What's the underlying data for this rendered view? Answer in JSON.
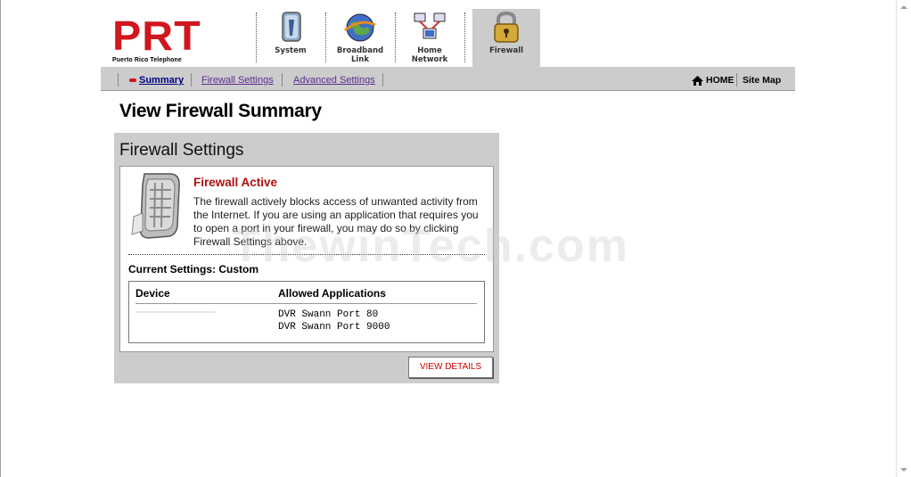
{
  "logo": {
    "text": "PRT",
    "tagline": "Puerto Rico Telephone"
  },
  "tabs": [
    {
      "label1": "System",
      "label2": "",
      "icon": "system-icon"
    },
    {
      "label1": "Broadband",
      "label2": "Link",
      "icon": "globe-icon"
    },
    {
      "label1": "Home",
      "label2": "Network",
      "icon": "network-icon"
    },
    {
      "label1": "Firewall",
      "label2": "",
      "icon": "padlock-icon",
      "active": true
    }
  ],
  "subnav": {
    "items": [
      {
        "label": "Summary",
        "active": true
      },
      {
        "label": "Firewall Settings"
      },
      {
        "label": "Advanced Settings"
      }
    ],
    "home": "HOME",
    "sitemap": "Site Map"
  },
  "page_title": "View Firewall Summary",
  "panel": {
    "title": "Firewall Settings",
    "status_heading": "Firewall Active",
    "description": "The firewall actively blocks access of unwanted activity from the Internet. If you are using an application that requires you to open a port in your firewall, you may do so by clicking Firewall Settings above.",
    "current_settings": "Current Settings: Custom",
    "table": {
      "headers": [
        "Device",
        "Allowed Applications"
      ],
      "applications": [
        "DVR Swann Port 80",
        "DVR Swann Port 9000"
      ]
    },
    "button": "VIEW DETAILS"
  },
  "watermark": "ThewinTech.com",
  "colors": {
    "brand_red": "#d0161e",
    "panel_gray": "#cccccc",
    "link_purple": "#5b2d8f"
  }
}
